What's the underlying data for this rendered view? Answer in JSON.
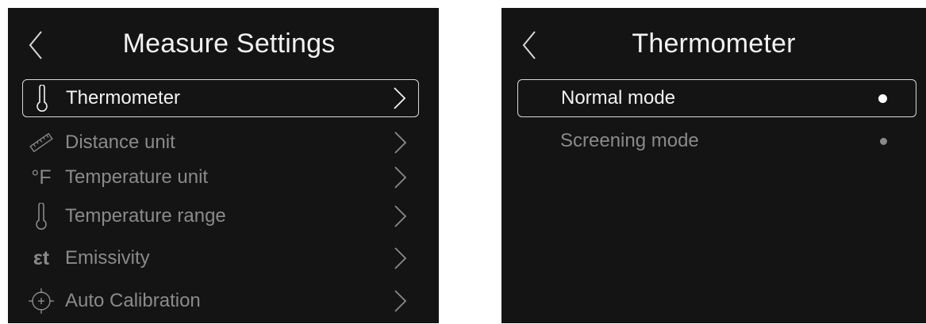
{
  "left": {
    "title": "Measure Settings",
    "back_icon": "chevron-left-icon",
    "items": [
      {
        "label": "Thermometer",
        "icon": "thermometer-icon",
        "selected": true
      },
      {
        "label": "Distance unit",
        "icon": "ruler-icon",
        "selected": false
      },
      {
        "label": "Temperature unit",
        "icon": "fahrenheit-icon",
        "icon_text": "°F",
        "selected": false
      },
      {
        "label": "Temperature range",
        "icon": "thermometer-icon",
        "selected": false
      },
      {
        "label": "Emissivity",
        "icon": "emissivity-icon",
        "icon_text": "εt",
        "selected": false
      },
      {
        "label": "Auto Calibration",
        "icon": "crosshair-icon",
        "selected": false
      }
    ]
  },
  "right": {
    "title": "Thermometer",
    "back_icon": "chevron-left-icon",
    "options": [
      {
        "label": "Normal mode",
        "selected": true
      },
      {
        "label": "Screening mode",
        "selected": false
      }
    ]
  },
  "colors": {
    "screen_bg": "#141414",
    "active_text": "#f2f2f2",
    "inactive_text": "#8a8a8a",
    "dot_active": "#ffffff",
    "dot_inactive": "#8a8a8a"
  }
}
